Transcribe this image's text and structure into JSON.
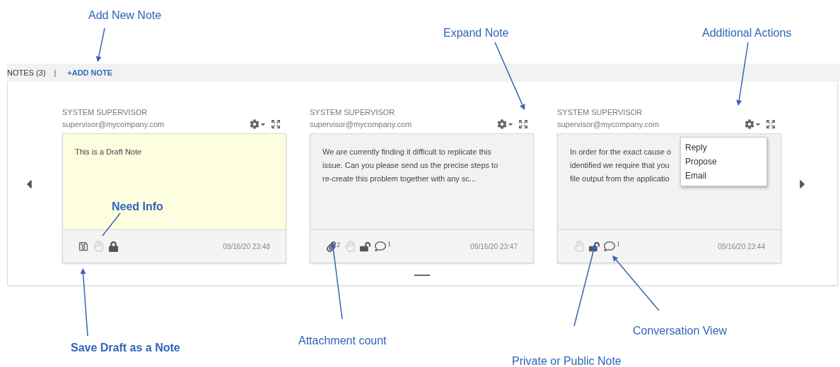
{
  "header": {
    "title": "NOTES (3)",
    "separator": "|",
    "add_button": "+ADD NOTE"
  },
  "notes": [
    {
      "author": "SYSTEM SUPERVISOR",
      "email": "supervisor@mycompany.com",
      "kind": "draft",
      "lines": [
        "This is a Draft Note"
      ],
      "footer_icons": [
        {
          "kind": "save"
        },
        {
          "kind": "hand"
        },
        {
          "kind": "lock",
          "locked": true
        }
      ],
      "timestamp": "09/16/20 23:48"
    },
    {
      "author": "SYSTEM SUPERVISOR",
      "email": "supervisor@mycompany.com",
      "kind": "note",
      "lines": [
        "We are currently finding it difficult to replicate this",
        "issue. Can you please send us the precise steps to",
        "re-create this problem together with any sc..."
      ],
      "footer_icons": [
        {
          "kind": "attachment",
          "count": "2"
        },
        {
          "kind": "hand"
        },
        {
          "kind": "lock",
          "locked": false
        },
        {
          "kind": "comment",
          "count": "1"
        }
      ],
      "timestamp": "09/16/20 23:47"
    },
    {
      "author": "SYSTEM SUPERVISOR",
      "email": "supervisor@mycompany.com",
      "kind": "note",
      "lines": [
        "In order for the exact cause o",
        "identified we require that you",
        "file output from the applicatio"
      ],
      "footer_icons": [
        {
          "kind": "hand"
        },
        {
          "kind": "lock",
          "locked": false
        },
        {
          "kind": "comment",
          "count": "1"
        }
      ],
      "timestamp": "09/16/20 23:44",
      "menu": [
        "Reply",
        "Propose",
        "Email"
      ]
    }
  ],
  "callouts": [
    {
      "text": "Add New Note",
      "bold": false
    },
    {
      "text": "Expand Note",
      "bold": false
    },
    {
      "text": "Additional Actions",
      "bold": false
    },
    {
      "text": "Need Info",
      "bold": true
    },
    {
      "text": "Save Draft as a Note",
      "bold": true
    },
    {
      "text": "Attachment count",
      "bold": false
    },
    {
      "text": "Private or Public Note",
      "bold": false
    },
    {
      "text": "Conversation View",
      "bold": false
    }
  ]
}
